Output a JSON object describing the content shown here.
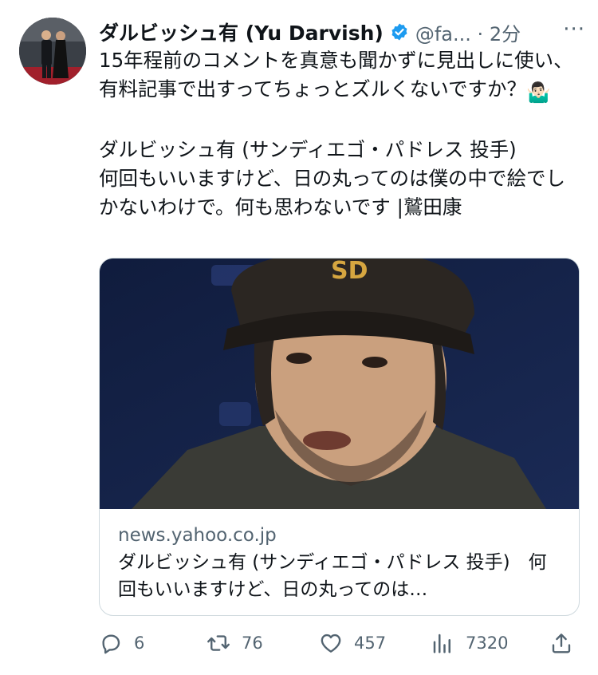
{
  "user": {
    "display_name": "ダルビッシュ有 (Yu Darvish)",
    "handle": "@fa...",
    "separator": "·",
    "time": "2分",
    "verified_color": "#1d9bf0"
  },
  "tweet": {
    "text": "15年程前のコメントを真意も聞かずに見出しに使い、有料記事で出すってちょっとズルくないですか？",
    "emoji": "🤷🏻‍♂️",
    "quoted_text": "ダルビッシュ有 (サンディエゴ・パドレス 投手)\n何回もいいますけど、日の丸ってのは僕の中で絵でしかないわけで。何も思わないです |鷲田康"
  },
  "link_card": {
    "cap_logo": "SD",
    "domain": "news.yahoo.co.jp",
    "title": "ダルビッシュ有 (サンディエゴ・パドレス 投手)　何回もいいますけど、日の丸ってのは…"
  },
  "actions": {
    "reply_icon": "reply-icon",
    "replies": "6",
    "retweet_icon": "retweet-icon",
    "retweets": "76",
    "like_icon": "heart-icon",
    "likes": "457",
    "views_icon": "views-icon",
    "views": "7320",
    "share_icon": "share-icon"
  },
  "colors": {
    "text": "#0f1419",
    "secondary": "#536471",
    "border": "#cfd9de"
  }
}
